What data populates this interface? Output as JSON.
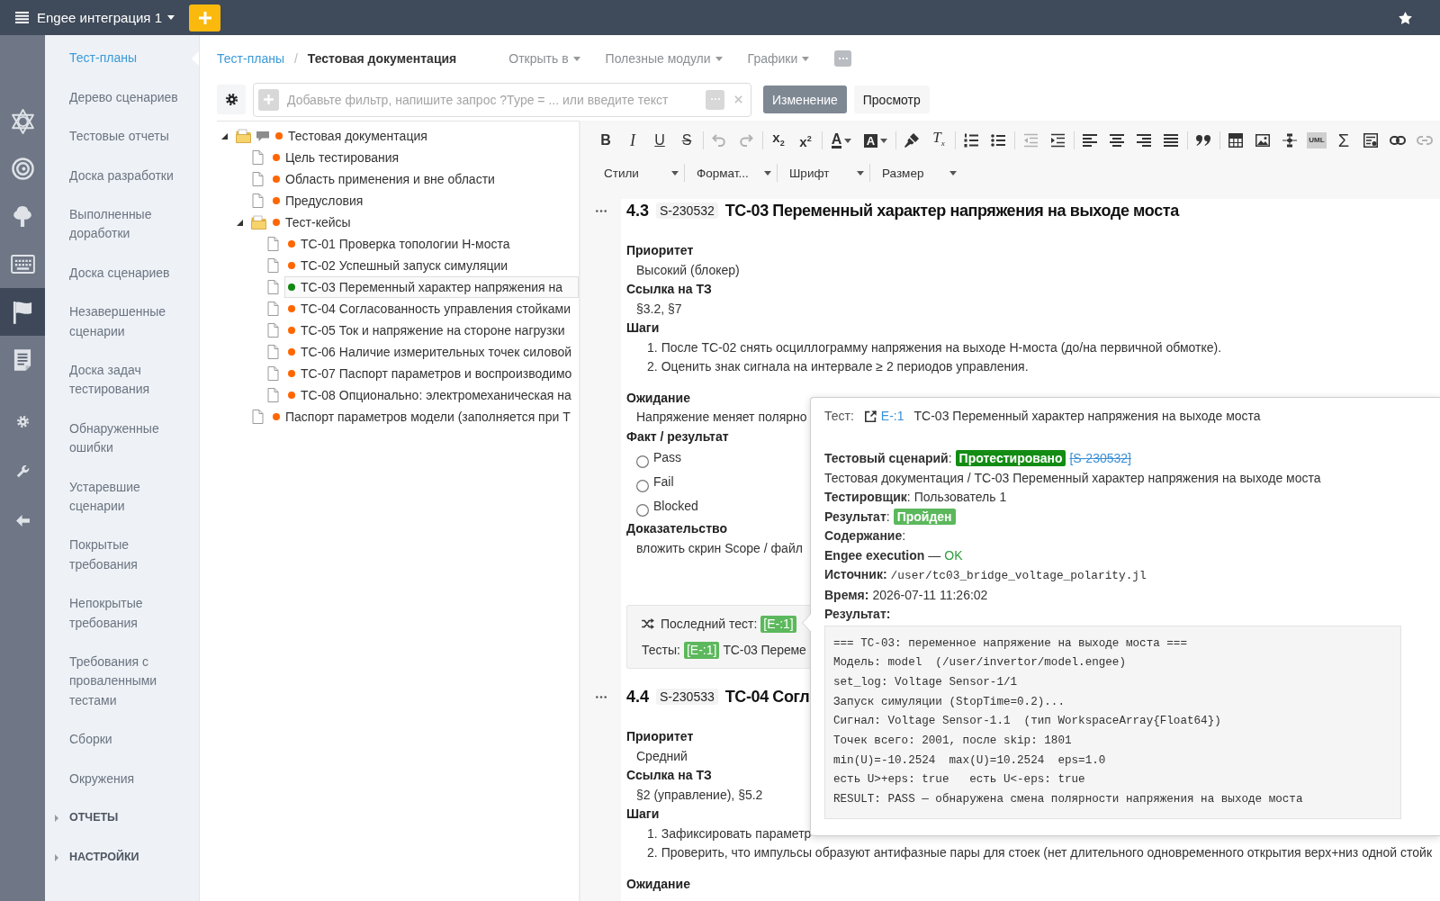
{
  "topbar": {
    "project": "Engee интеграция 1"
  },
  "rail": {
    "main": [
      {
        "kind": "logo",
        "selected": false
      },
      {
        "kind": "spiral",
        "selected": false
      },
      {
        "kind": "tree",
        "selected": false
      },
      {
        "kind": "keyboard",
        "selected": false
      },
      {
        "kind": "flag",
        "selected": true
      },
      {
        "kind": "document",
        "selected": false
      }
    ],
    "tools": [
      {
        "kind": "gear",
        "selected": false
      },
      {
        "kind": "wrench",
        "selected": false
      },
      {
        "kind": "back",
        "selected": false
      }
    ]
  },
  "sidebar": {
    "items": [
      {
        "label": "Тест-планы",
        "selected": true
      },
      {
        "label": "Дерево сценариев",
        "selected": false
      },
      {
        "label": "Тестовые отчеты",
        "selected": false
      },
      {
        "label": "Доска разработки",
        "selected": false
      },
      {
        "label": "Выполненные доработки",
        "selected": false
      },
      {
        "label": "Доска сценариев",
        "selected": false
      },
      {
        "label": "Незавершенные сценарии",
        "selected": false
      },
      {
        "label": "Доска задач тестирования",
        "selected": false
      },
      {
        "label": "Обнаруженные ошибки",
        "selected": false
      },
      {
        "label": "Устаревшие сценарии",
        "selected": false
      },
      {
        "label": "Покрытые требования",
        "selected": false
      },
      {
        "label": "Непокрытые требования",
        "selected": false
      },
      {
        "label": "Требования с проваленными тестами",
        "selected": false
      },
      {
        "label": "Сборки",
        "selected": false
      },
      {
        "label": "Окружения",
        "selected": false
      }
    ],
    "sections": [
      {
        "label": "ОТЧЕТЫ",
        "expanded": false
      },
      {
        "label": "НАСТРОЙКИ",
        "expanded": false
      }
    ]
  },
  "breadcrumb": {
    "items": [
      {
        "label": "Тест-планы",
        "kind": "link"
      },
      {
        "label": "Тестовая документация",
        "kind": "current"
      }
    ],
    "separator": "/"
  },
  "menus": [
    {
      "label": "Открыть в"
    },
    {
      "label": "Полезные модули"
    },
    {
      "label": "Графики"
    }
  ],
  "filter": {
    "placeholder": "Добавьте фильтр, напишите запрос ?Type = ... или введите текст"
  },
  "mode_tabs": [
    {
      "label": "Изменение",
      "selected": true
    },
    {
      "label": "Просмотр",
      "selected": false
    }
  ],
  "tree": [
    {
      "label": "Тестовая документация",
      "kind": "folder",
      "expanded": true,
      "selected": false,
      "comment": true,
      "color": "#ff6600",
      "children": [
        {
          "label": "Цель тестирования",
          "kind": "page",
          "selected": false,
          "comment": false,
          "color": "#ff6600"
        },
        {
          "label": "Область применения и вне области",
          "kind": "page",
          "selected": false,
          "comment": false,
          "color": "#ff6600"
        },
        {
          "label": "Предусловия",
          "kind": "page",
          "selected": false,
          "comment": false,
          "color": "#ff6600"
        },
        {
          "label": "Тест-кейсы",
          "kind": "folder",
          "expanded": true,
          "selected": false,
          "comment": false,
          "color": "#ff6600",
          "children": [
            {
              "label": "ТС-01 Проверка топологии Н-моста",
              "kind": "page",
              "selected": false,
              "comment": false,
              "color": "#ff6600"
            },
            {
              "label": "ТС-02 Успешный запуск симуляции",
              "kind": "page",
              "selected": false,
              "comment": false,
              "color": "#ff6600"
            },
            {
              "label": "ТС-03 Переменный характер напряжения на",
              "kind": "page",
              "selected": true,
              "comment": false,
              "color": "#118811"
            },
            {
              "label": "ТС-04 Согласованность управления стойками",
              "kind": "page",
              "selected": false,
              "comment": false,
              "color": "#ff6600"
            },
            {
              "label": "ТС-05 Ток и напряжение на стороне нагрузки",
              "kind": "page",
              "selected": false,
              "comment": false,
              "color": "#ff6600"
            },
            {
              "label": "ТС-06 Наличие измерительных точек силовой",
              "kind": "page",
              "selected": false,
              "comment": false,
              "color": "#ff6600"
            },
            {
              "label": "ТС-07 Паспорт параметров и воспроизводимо",
              "kind": "page",
              "selected": false,
              "comment": false,
              "color": "#ff6600"
            },
            {
              "label": "ТС-08 Опционально: электромеханическая на",
              "kind": "page",
              "selected": false,
              "comment": false,
              "color": "#ff6600"
            }
          ]
        },
        {
          "label": "Паспорт параметров модели (заполняется при Т",
          "kind": "page",
          "selected": false,
          "comment": false,
          "color": "#ff6600"
        }
      ]
    }
  ],
  "editor_toolbar": {
    "groups": [
      [
        {
          "kind": "bold",
          "label": "B",
          "disabled": false
        },
        {
          "kind": "italic",
          "label": "I",
          "disabled": false
        },
        {
          "kind": "underline",
          "label": "U",
          "disabled": false
        },
        {
          "kind": "strike",
          "label": "S",
          "disabled": false
        }
      ],
      [
        {
          "kind": "undo",
          "disabled": true
        },
        {
          "kind": "redo",
          "disabled": true
        }
      ],
      [
        {
          "kind": "subscript",
          "label": "x$_{2}$",
          "disabled": false
        },
        {
          "kind": "superscript",
          "label": "x$^{2}$",
          "disabled": false
        }
      ],
      [
        {
          "kind": "text-color",
          "label": "A",
          "disabled": false
        },
        {
          "kind": "bg-color",
          "label": "A",
          "disabled": false
        }
      ],
      [
        {
          "kind": "format-painter",
          "disabled": false
        },
        {
          "kind": "clear-format",
          "label": "T$_{x}$",
          "disabled": false
        }
      ],
      [
        {
          "kind": "numbered-list",
          "disabled": false
        },
        {
          "kind": "bulleted-list",
          "disabled": false
        }
      ],
      [
        {
          "kind": "outdent",
          "disabled": true
        },
        {
          "kind": "indent",
          "disabled": false
        }
      ],
      [
        {
          "kind": "align-left",
          "disabled": false
        },
        {
          "kind": "align-center",
          "disabled": false
        },
        {
          "kind": "align-right",
          "disabled": false
        },
        {
          "kind": "justify",
          "disabled": false
        }
      ],
      [
        {
          "kind": "blockquote",
          "disabled": false
        }
      ],
      [
        {
          "kind": "table",
          "disabled": false
        },
        {
          "kind": "image",
          "disabled": false
        },
        {
          "kind": "diagram",
          "disabled": false
        },
        {
          "kind": "uml",
          "label": "UML",
          "disabled": false
        },
        {
          "kind": "formula",
          "label": "Σ",
          "disabled": false
        },
        {
          "kind": "template",
          "disabled": false
        },
        {
          "kind": "link",
          "disabled": false
        },
        {
          "kind": "unlink",
          "disabled": true
        }
      ]
    ],
    "dropdowns": [
      {
        "label": "Стили"
      },
      {
        "label": "Формат..."
      },
      {
        "label": "Шрифт"
      },
      {
        "label": "Размер"
      }
    ]
  },
  "sections": [
    {
      "number": "4.3",
      "code": "S-230532",
      "title": "ТС-03 Переменный характер напряжения на выходе моста",
      "fields": [
        {
          "kind": "text",
          "label": "Приоритет",
          "value": "Высокий (блокер)"
        },
        {
          "kind": "text",
          "label": "Ссылка на ТЗ",
          "value": "§3.2, §7"
        },
        {
          "kind": "steps",
          "label": "Шаги",
          "steps": [
            {
              "number": "1.",
              "text": "После ТС-02 снять осциллограмму напряжения на выходе Н-моста (до/на первичной обмотке)."
            },
            {
              "number": "2.",
              "text": "Оценить знак сигнала на интервале ≥ 2 периодов управления."
            }
          ]
        },
        {
          "kind": "text",
          "label": "Ожидание",
          "value": "Напряжение меняет полярно"
        },
        {
          "kind": "radio",
          "label": "Факт / результат",
          "options": [
            {
              "label": "Pass",
              "selected": false
            },
            {
              "label": "Fail",
              "selected": false
            },
            {
              "label": "Blocked",
              "selected": false
            }
          ]
        },
        {
          "kind": "text",
          "label": "Доказательство",
          "value": "вложить скрин Scope / файл"
        }
      ],
      "last_test": {
        "label": "Последний тест:",
        "run": "[E-:1]",
        "tests_label": "Тесты:",
        "tests_run": "[E-:1]",
        "tests_title": "ТС-03 Переме"
      }
    },
    {
      "number": "4.4",
      "code": "S-230533",
      "title": "ТС-04 Согл",
      "fields": [
        {
          "kind": "text",
          "label": "Приоритет",
          "value": "Средний"
        },
        {
          "kind": "text",
          "label": "Ссылка на ТЗ",
          "value": "§2 (управление), §5.2"
        },
        {
          "kind": "steps",
          "label": "Шаги",
          "steps": [
            {
              "number": "1.",
              "text": "Зафиксировать параметр"
            },
            {
              "number": "2.",
              "text": "Проверить, что импульсы образуют антифазные пары для стоек (нет длительного одновременного открытия верх+низ одной стойк"
            }
          ]
        },
        {
          "kind": "text",
          "label": "Ожидание"
        }
      ]
    }
  ],
  "popover": {
    "test": {
      "label": "Тест:",
      "link": "E-:1",
      "title": "ТС-03 Переменный характер напряжения на выходе моста"
    },
    "scenario": {
      "label": "**Тестовый сценарий**:",
      "status": "Протестировано",
      "link": "[S-230532]",
      "struck": true,
      "path": "Тестовая документация / ТС-03 Переменный характер напряжения на выходе моста"
    },
    "tester": {
      "label": "**Тестировщик**:",
      "value": "Пользователь 1"
    },
    "result": {
      "label": "**Результат**:",
      "status": "Пройден"
    },
    "content": {
      "label": "**Содержание**:"
    },
    "execution": {
      "title": "Engee execution",
      "separator": "—",
      "status": "OK",
      "passed": true
    },
    "source": {
      "label": "Источник:",
      "value": "/user/tc03_bridge_voltage_polarity.jl"
    },
    "time": {
      "label": "Время:",
      "value": "2026-07-11 11:26:02"
    },
    "output": {
      "label": "Результат:",
      "lines": [
        "=== ТС-03: переменное напряжение на выходе моста ===",
        "Модель: model  (/user/invertor/model.engee)",
        "set_log: Voltage Sensor-1/1",
        "Запуск симуляции (StopTime=0.2)...",
        "Сигнал: Voltage Sensor-1.1  (тип WorkspaceArray{Float64})",
        "Точек всего: 2001, после skip: 1801",
        "min(U)=-10.2524  max(U)=10.2524  eps=1.0",
        "есть U>+eps: true   есть U<-eps: true",
        "RESULT: PASS — обнаружена смена полярности напряжения на выходе моста"
      ]
    }
  }
}
